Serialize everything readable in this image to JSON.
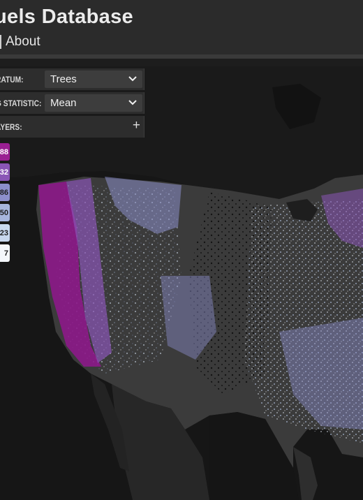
{
  "header": {
    "title": "uels Database",
    "nav_about": "About"
  },
  "controls": {
    "stratum": {
      "label": "RATUM:",
      "value": "Trees"
    },
    "statistic": {
      "label": "G STATISTIC:",
      "value": "Mean"
    },
    "layers": {
      "label": "AYERS:",
      "add_icon": "+"
    }
  },
  "legend": {
    "items": [
      {
        "label": "88",
        "color": "#9a1f92",
        "text_color": "#ffffff"
      },
      {
        "label": "32",
        "color": "#8a56b6",
        "text_color": "#ffffff"
      },
      {
        "label": "86",
        "color": "#8c8fcb",
        "text_color": "#1e1e1e"
      },
      {
        "label": "50",
        "color": "#a6b5dd",
        "text_color": "#1e1e1e"
      },
      {
        "label": "23",
        "color": "#c8d8ee",
        "text_color": "#1e1e1e"
      },
      {
        "label": "7",
        "color": "#f4f7fb",
        "text_color": "#1e1e1e"
      }
    ]
  },
  "map": {
    "icon": "map-icon",
    "ocean_color": "#161616",
    "land_color": "#3b3b3b"
  }
}
